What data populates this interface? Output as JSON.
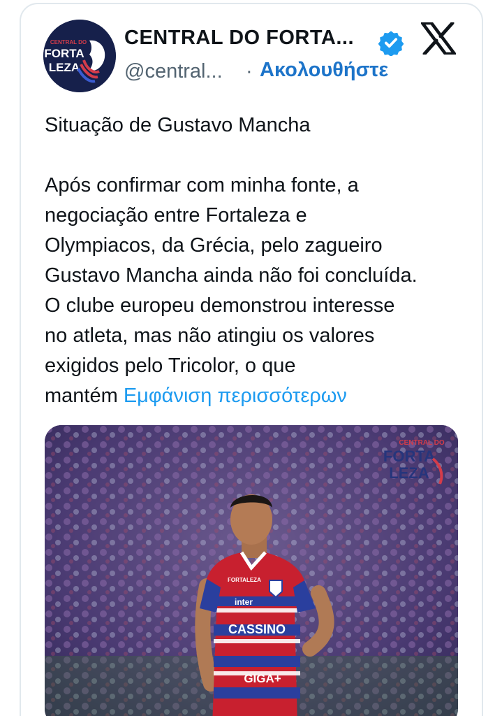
{
  "account": {
    "display_name": "CENTRAL DO FORTA...",
    "handle": "@central...",
    "separator": "·",
    "follow_label": "Ακολουθήστε",
    "avatar_text_top": "CENTRAL DO",
    "avatar_text_mid": "FORTA",
    "avatar_text_bottom": "LEZA"
  },
  "tweet": {
    "line_title": "Situação de Gustavo Mancha",
    "lines": [
      "Após confirmar com minha fonte, a",
      "negociação entre Fortaleza e",
      "Olympiacos, da Grécia, pelo zagueiro",
      "Gustavo Mancha ainda não foi concluída.",
      "O clube europeu demonstrou interesse",
      "no atleta, mas não atingiu os valores",
      "exigidos pelo Tricolor, o que"
    ],
    "last_line_start": "mantém",
    "show_more_label": "Εμφάνιση περισσότερων"
  },
  "media": {
    "watermark_top": "CENTRAL DO",
    "watermark_mid": "FORTA",
    "watermark_bottom": "LEZA",
    "jersey_sponsor_1": "inter",
    "jersey_sponsor_2": "CASSINO",
    "jersey_sponsor_3": "GIGA+",
    "jersey_brand": "FORTALEZA"
  },
  "colors": {
    "link": "#1d9bf0",
    "follow": "#1d74c9",
    "verified": "#1d9bf0",
    "avatar_bg": "#16204b",
    "jersey_red": "#c8202f",
    "jersey_blue": "#2a3f9e"
  }
}
